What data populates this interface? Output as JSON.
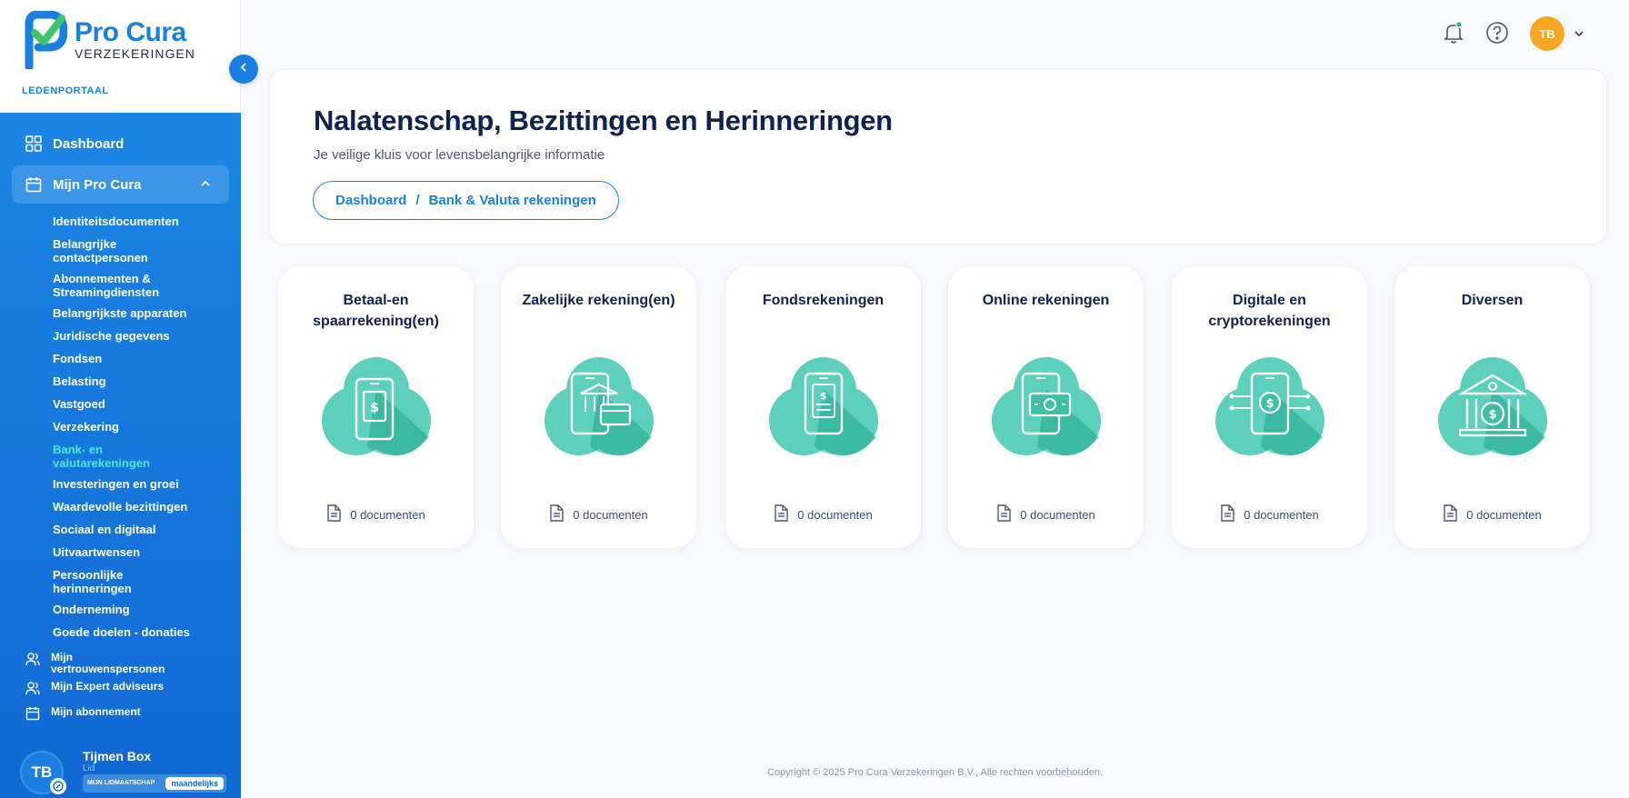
{
  "brand": {
    "title": "Pro Cura",
    "subtitle": "VERZEKERINGEN",
    "portal_label": "LEDENPORTAAL"
  },
  "nav": {
    "dashboard": "Dashboard",
    "mijn_pro_cura": "Mijn Pro Cura",
    "sub_items": [
      "Identiteitsdocumenten",
      "Belangrijke contactpersonen",
      "Abonnementen & Streamingdiensten",
      "Belangrijkste apparaten",
      "Juridische gegevens",
      "Fondsen",
      "Belasting",
      "Vastgoed",
      "Verzekering",
      "Bank- en valutarekeningen",
      "Investeringen en groei",
      "Waardevolle bezittingen",
      "Sociaal en digitaal",
      "Uitvaartwensen",
      "Persoonlijke herinneringen",
      "Onderneming",
      "Goede doelen - donaties"
    ],
    "current_sub_index": 9,
    "vertrouwenspersonen": "Mijn vertrouwenspersonen",
    "expert_adviseurs": "Mijn Expert adviseurs",
    "abonnement": "Mijn abonnement"
  },
  "user": {
    "initials": "TB",
    "name": "Tijmen Box",
    "role": "Lid",
    "membership_label": "MIJN LIDMAATSCHAP",
    "membership_value": "maandelijks"
  },
  "topbar": {
    "avatar_initials": "TB",
    "icons": [
      "bell-icon",
      "help-icon",
      "chevron-down-icon"
    ]
  },
  "header": {
    "title": "Nalatenschap, Bezittingen en Herinneringen",
    "subtitle": "Je veilige kluis voor levensbelangrijke informatie",
    "breadcrumb": [
      "Dashboard",
      "Bank & Valuta rekeningen"
    ],
    "separator": "/"
  },
  "cards": [
    {
      "title": "Betaal-en spaarrekening(en)",
      "icon": "phone-safe-icon",
      "docs": "0 documenten"
    },
    {
      "title": "Zakelijke rekening(en)",
      "icon": "phone-bank-card-icon",
      "docs": "0 documenten"
    },
    {
      "title": "Fondsrekeningen",
      "icon": "phone-invoice-icon",
      "docs": "0 documenten"
    },
    {
      "title": "Online rekeningen",
      "icon": "phone-cash-icon",
      "docs": "0 documenten"
    },
    {
      "title": "Digitale en cryptorekeningen",
      "icon": "phone-crypto-icon",
      "docs": "0 documenten"
    },
    {
      "title": "Diversen",
      "icon": "bank-building-icon",
      "docs": "0 documenten"
    }
  ],
  "colors": {
    "primary": "#1a7fe0",
    "sidebar": "#1169d4",
    "accent_teal": "#4ecdb8",
    "avatar_orange": "#f6a623"
  },
  "footer": "Copyright © 2025 Pro Cura Verzekeringen B.V., Alle rechten voorbehouden."
}
